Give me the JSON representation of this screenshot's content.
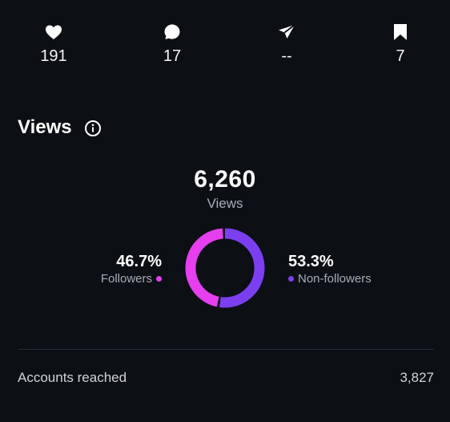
{
  "stats": [
    {
      "icon": "heart-icon",
      "value": "191"
    },
    {
      "icon": "comment-icon",
      "value": "17"
    },
    {
      "icon": "send-icon",
      "value": "--"
    },
    {
      "icon": "bookmark-icon",
      "value": "7"
    }
  ],
  "views": {
    "title": "Views",
    "total": "6,260",
    "total_label": "Views",
    "followers": {
      "pct": "46.7%",
      "label": "Followers",
      "color": "#e53ff0",
      "fraction": 0.467
    },
    "non_followers": {
      "pct": "53.3%",
      "label": "Non-followers",
      "color": "#7b3ff0",
      "fraction": 0.533
    }
  },
  "accounts_reached": {
    "label": "Accounts reached",
    "value": "3,827"
  },
  "colors": {
    "background": "#0c0f14",
    "text": "#ffffff",
    "muted": "#a8acb3",
    "divider": "#262a31"
  }
}
